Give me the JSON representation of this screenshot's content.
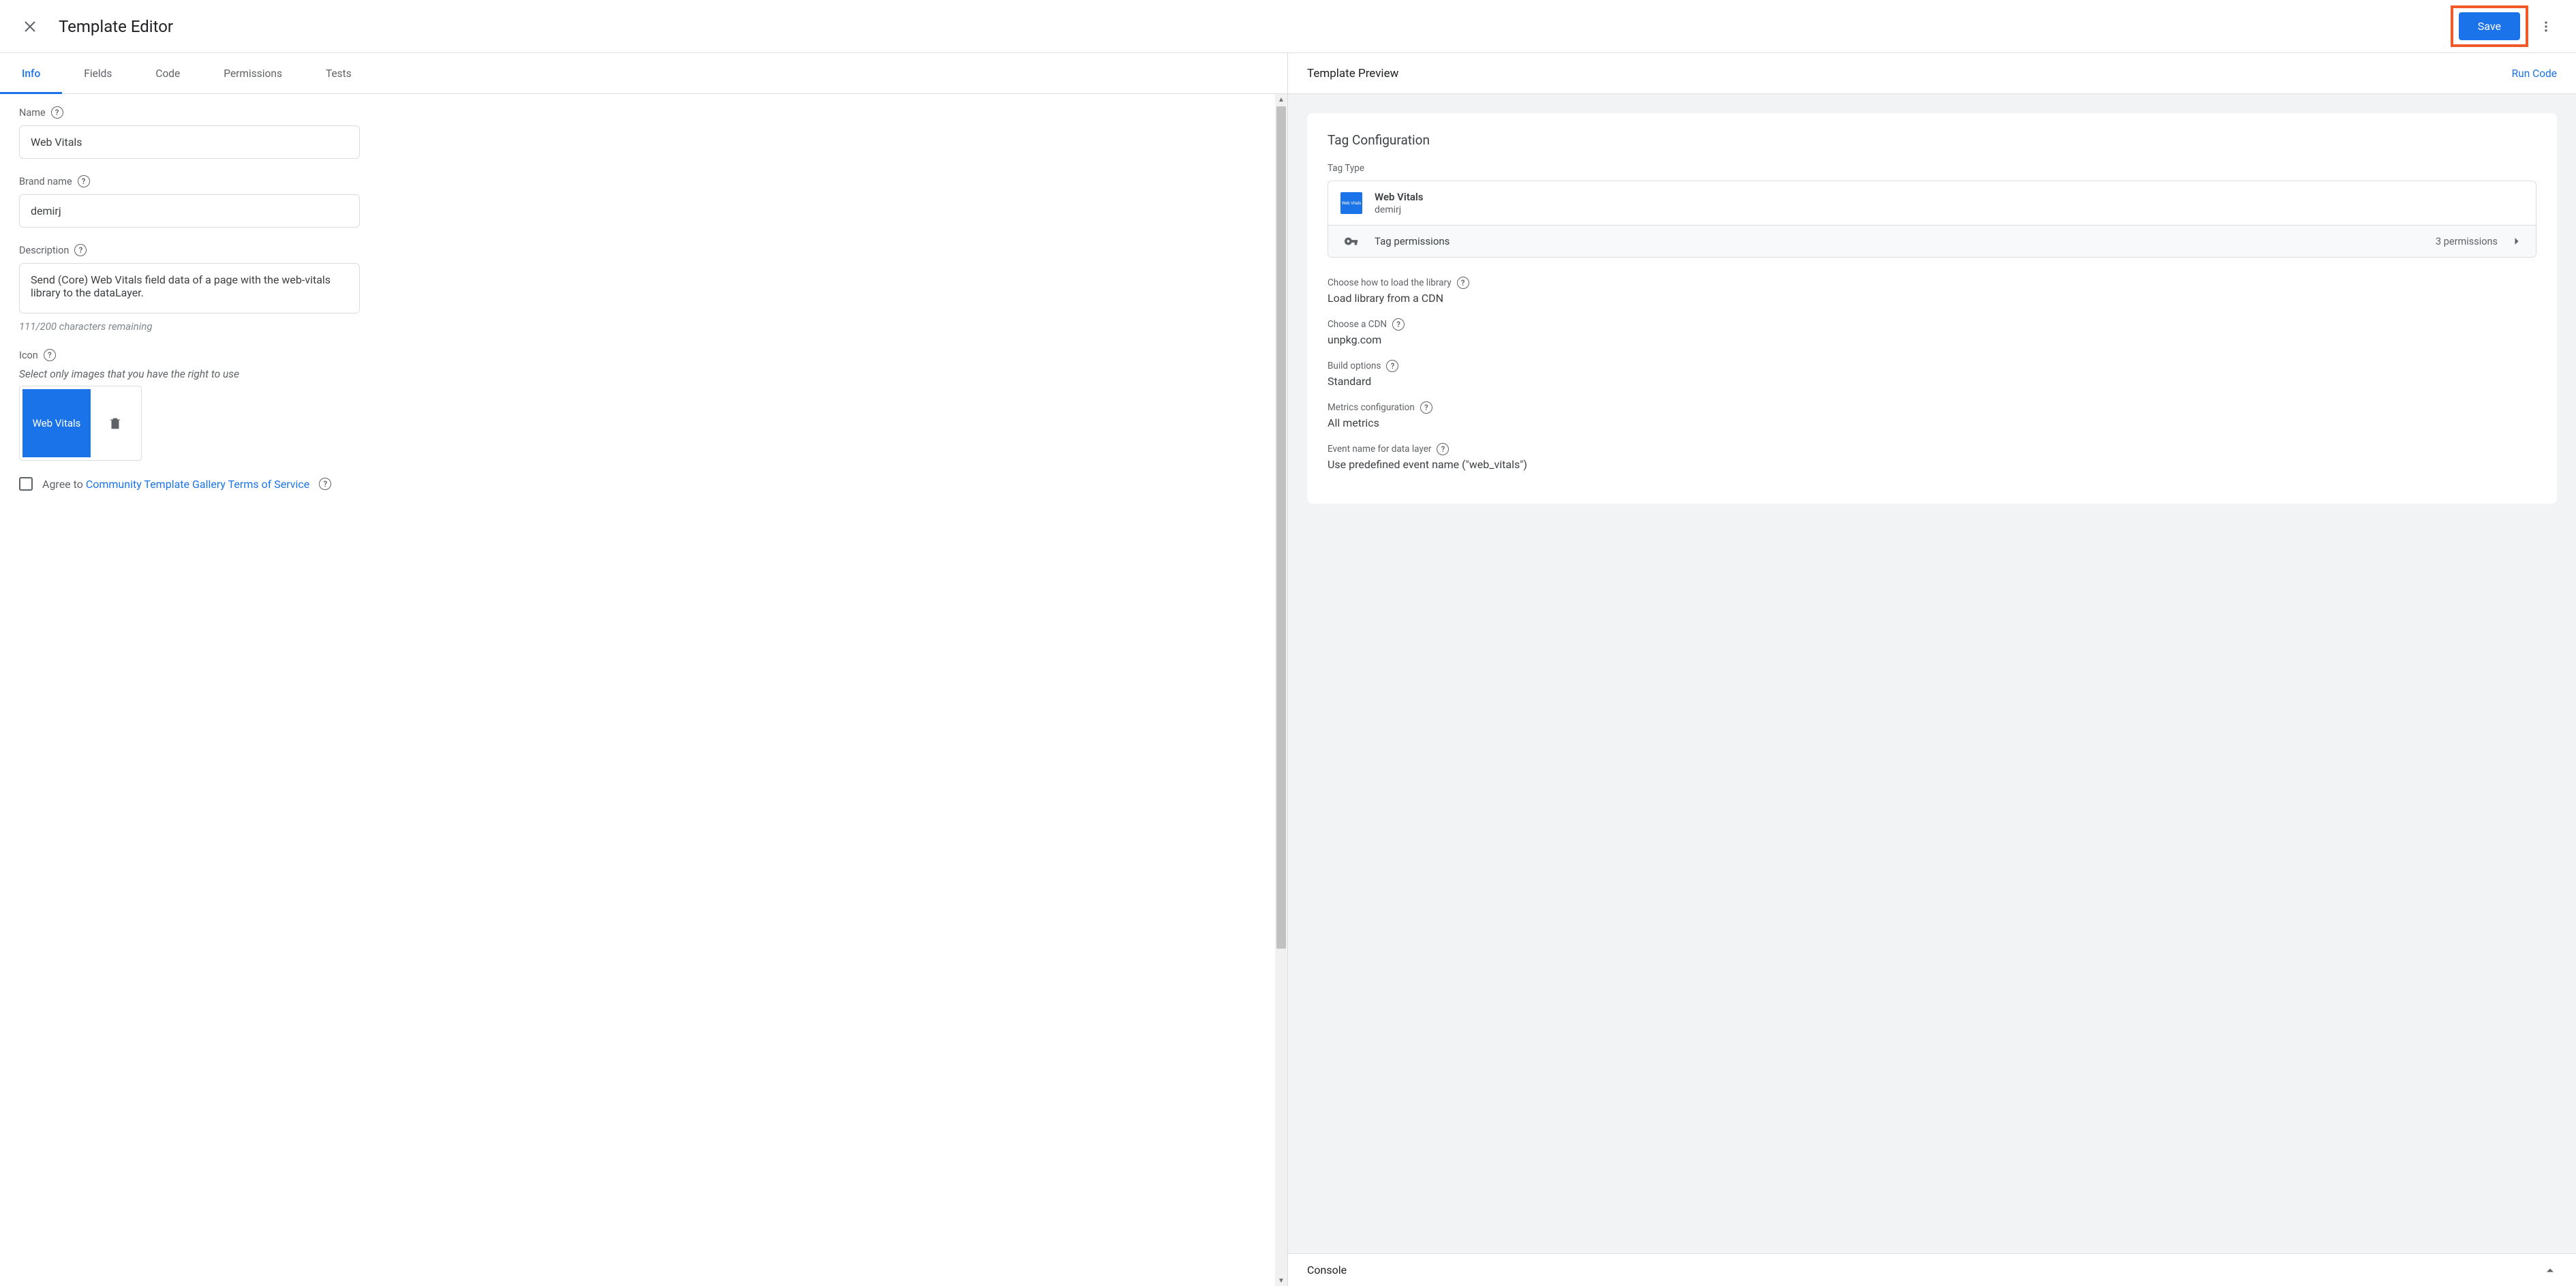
{
  "header": {
    "title": "Template Editor",
    "save_label": "Save"
  },
  "tabs": [
    "Info",
    "Fields",
    "Code",
    "Permissions",
    "Tests"
  ],
  "form": {
    "name_label": "Name",
    "name_value": "Web Vitals",
    "brand_label": "Brand name",
    "brand_value": "demirj",
    "description_label": "Description",
    "description_value": "Send (Core) Web Vitals field data of a page with the web-vitals library to the dataLayer.",
    "char_count": "111/200 characters remaining",
    "icon_label": "Icon",
    "icon_hint": "Select only images that you have the right to use",
    "icon_tile_text": "Web Vitals",
    "agree_prefix": "Agree to ",
    "agree_link": "Community Template Gallery Terms of Service"
  },
  "preview": {
    "title": "Template Preview",
    "run_code": "Run Code",
    "configuration": {
      "section_title": "Tag Configuration",
      "tag_type_label": "Tag Type",
      "tag_name": "Web Vitals",
      "tag_brand": "demirj",
      "permissions_label": "Tag permissions",
      "permissions_count": "3 permissions",
      "groups": [
        {
          "label": "Choose how to load the library",
          "value": "Load library from a CDN",
          "help": true
        },
        {
          "label": "Choose a CDN",
          "value": "unpkg.com",
          "help": true
        },
        {
          "label": "Build options",
          "value": "Standard",
          "help": true
        },
        {
          "label": "Metrics configuration",
          "value": "All metrics",
          "help": true
        },
        {
          "label": "Event name for data layer",
          "value": "Use predefined event name (\"web_vitals\")",
          "help": true
        }
      ]
    },
    "console_label": "Console"
  }
}
